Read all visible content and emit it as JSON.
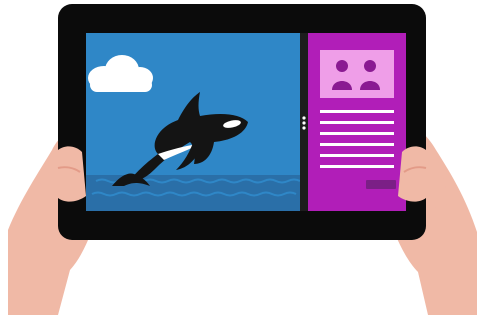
{
  "scene": {
    "kind": "illustration",
    "device": "tablet",
    "split_view": true
  },
  "colors": {
    "background": "#ffffff",
    "tablet_frame": "#0b0b0b",
    "sea_sky": "#2f87c7",
    "water_band": "#2a6fa8",
    "cloud": "#ffffff",
    "orca_black": "#141414",
    "orca_white": "#ffffff",
    "side_panel": "#b11eb8",
    "side_panel_header": "#ef9ee8",
    "people_icon": "#8a1a92",
    "panel_lines": "#ffffff",
    "panel_button": "#7b1f86",
    "skin": "#f0b9a6",
    "skin_shadow": "#e39b88",
    "divider_dots": "#ffffff"
  },
  "icons": {
    "cloud": "cloud-icon",
    "people": "people-icon",
    "divider_handle": "drag-handle-icon",
    "orca": "orca-illustration"
  },
  "side_panel": {
    "text_line_count": 6
  }
}
